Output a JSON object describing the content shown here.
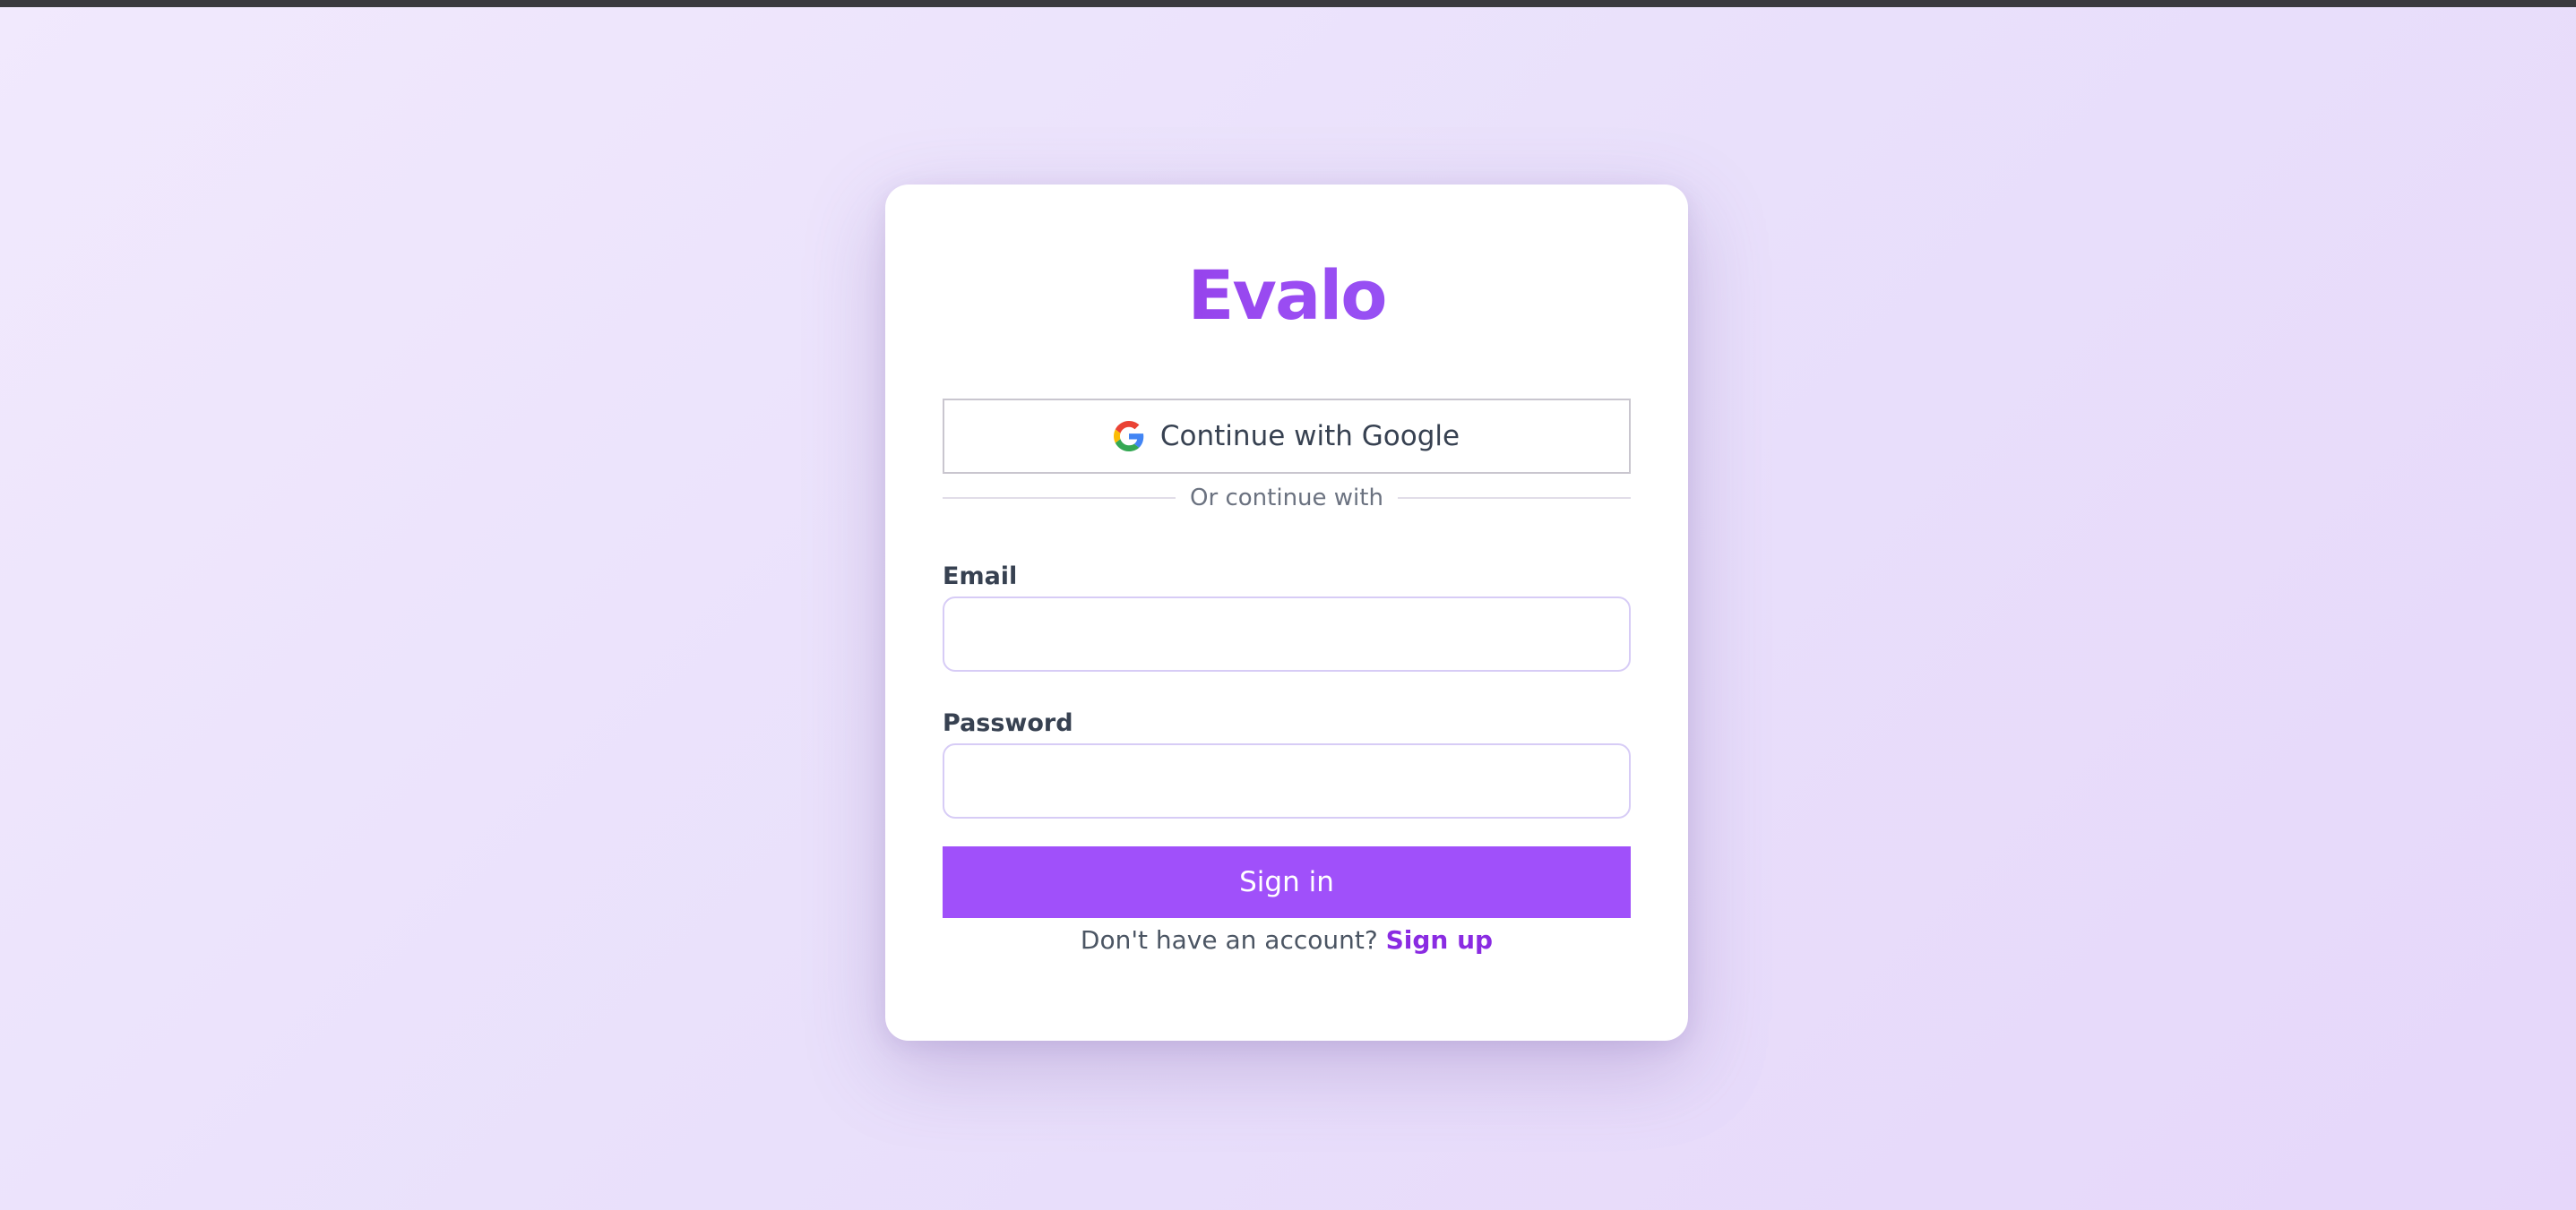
{
  "app": {
    "logo_text": "Evalo"
  },
  "google_signin": {
    "label": "Continue with Google",
    "icon": "google-icon"
  },
  "divider": {
    "text": "Or continue with"
  },
  "form": {
    "email": {
      "label": "Email",
      "value": "",
      "placeholder": ""
    },
    "password": {
      "label": "Password",
      "value": "",
      "placeholder": ""
    },
    "submit_label": "Sign in"
  },
  "signup": {
    "prompt": "Don't have an account?",
    "link_label": "Sign up"
  },
  "colors": {
    "primary_button": "#a050fa",
    "link": "#8a2be2",
    "logo_gradient_start": "#8a28d9",
    "logo_gradient_end": "#8b5cf6",
    "background": "#ebe0fb"
  }
}
